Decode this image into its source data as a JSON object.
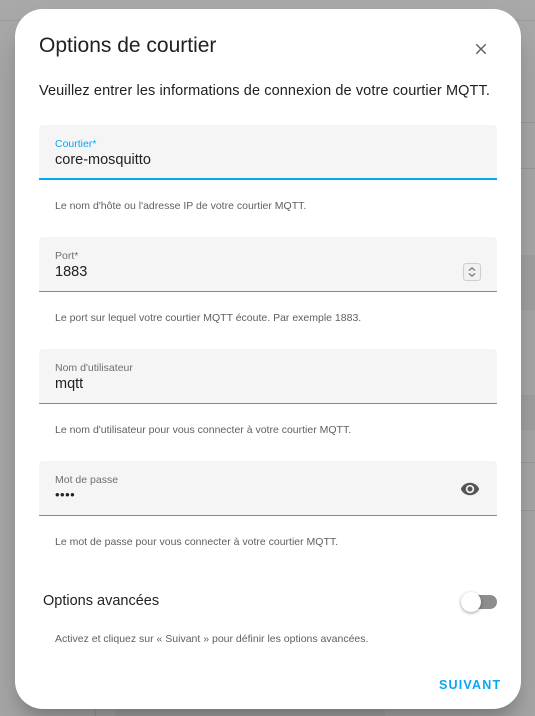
{
  "dialog": {
    "title": "Options de courtier",
    "description": "Veuillez entrer les informations de connexion de votre courtier MQTT.",
    "close_icon": "close-icon"
  },
  "fields": {
    "broker": {
      "label": "Courtier*",
      "value": "core-mosquitto",
      "helper": "Le nom d'hôte ou l'adresse IP de votre courtier MQTT."
    },
    "port": {
      "label": "Port*",
      "value": "1883",
      "helper": "Le port sur lequel votre courtier MQTT écoute. Par exemple 1883.",
      "icon": "chevron-up-down-icon"
    },
    "username": {
      "label": "Nom d'utilisateur",
      "value": "mqtt",
      "helper": "Le nom d'utilisateur pour vous connecter à votre courtier MQTT."
    },
    "password": {
      "label": "Mot de passe",
      "value": "••••",
      "helper": "Le mot de passe pour vous connecter à votre courtier MQTT.",
      "icon": "eye-icon"
    }
  },
  "advanced": {
    "label": "Options avancées",
    "enabled": false,
    "helper": "Activez et cliquez sur « Suivant » pour définir les options avancées."
  },
  "actions": {
    "submit_label": "SUIVANT"
  },
  "colors": {
    "accent": "#03a9f4",
    "field_background": "#f5f5f5",
    "text_primary": "#212121"
  }
}
